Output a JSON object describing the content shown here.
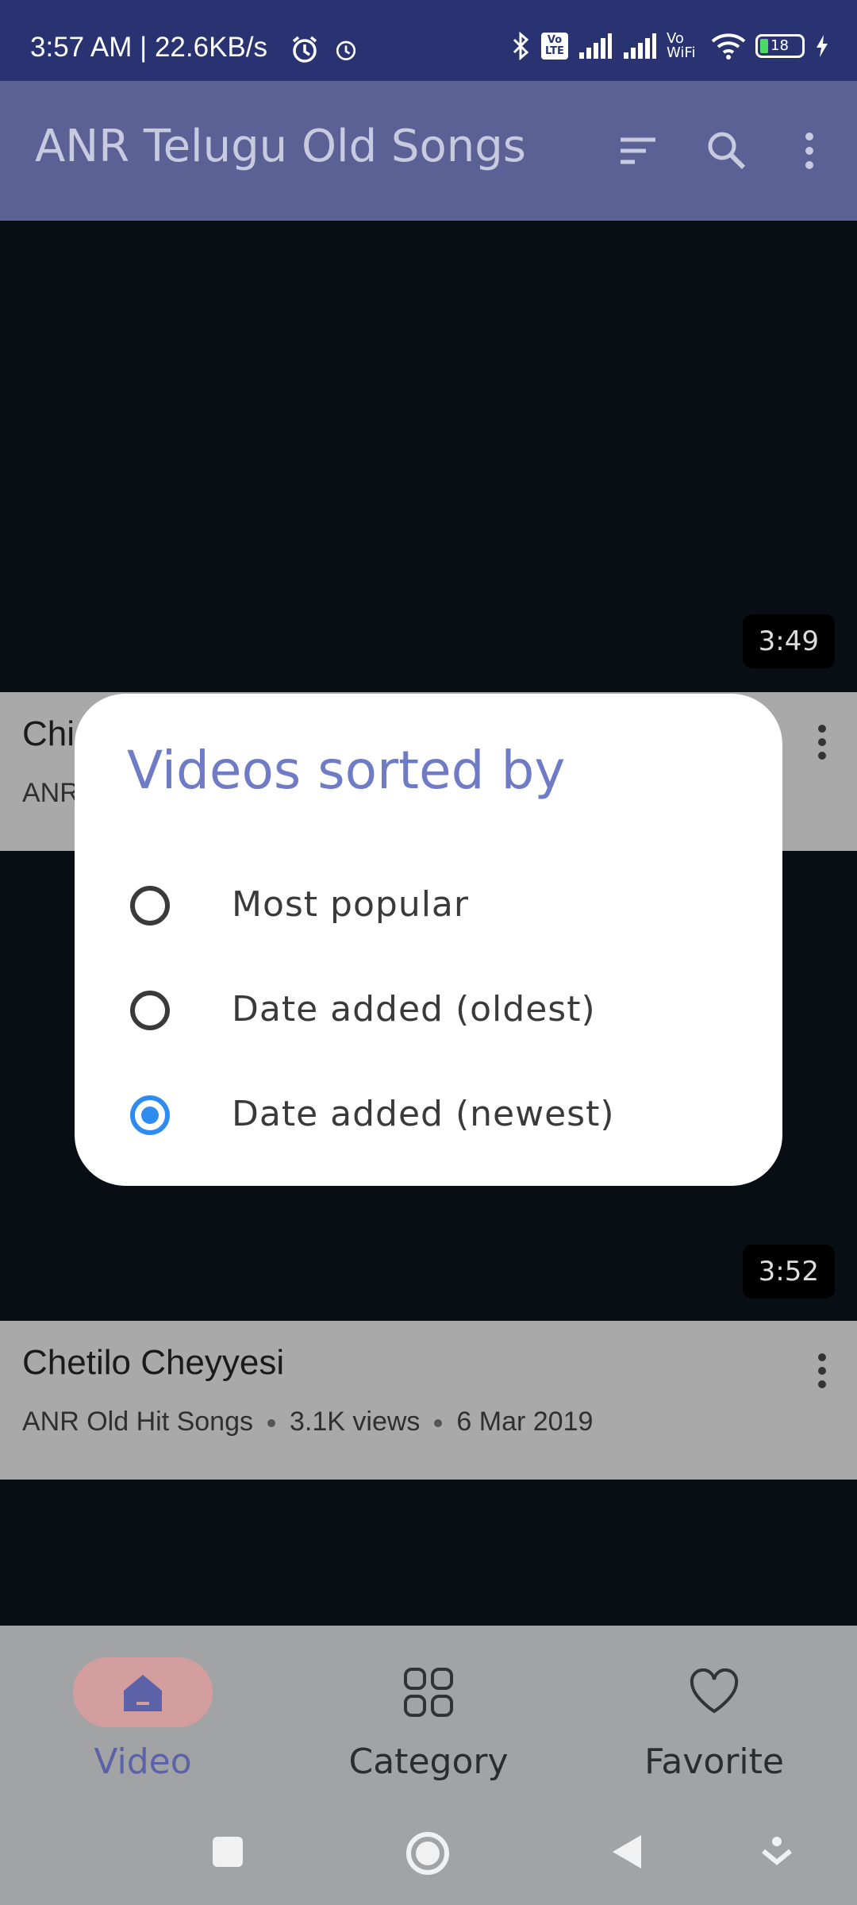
{
  "status_bar": {
    "time_speed": "3:57 AM | 22.6KB/s",
    "network": [
      "Vo LTE",
      "Vo WiFi"
    ],
    "battery": "18"
  },
  "app_bar": {
    "title": "ANR Telugu Old Songs",
    "actions": [
      "sort-icon",
      "search-icon",
      "more-vert-icon"
    ]
  },
  "videos": [
    {
      "duration": "3:49",
      "title": "Chi",
      "meta": "ANR"
    },
    {
      "duration": "3:52",
      "title": "Chetilo Cheyyesi",
      "channel": "ANR Old Hit Songs",
      "views": "3.1K views",
      "date": "6 Mar 2019"
    }
  ],
  "dialog": {
    "title": "Videos sorted by",
    "options": [
      {
        "label": "Most popular",
        "selected": false
      },
      {
        "label": "Date added (oldest)",
        "selected": false
      },
      {
        "label": "Date added (newest)",
        "selected": true
      }
    ]
  },
  "bottom_nav": {
    "items": [
      {
        "label": "Video",
        "icon": "home-icon",
        "active": true
      },
      {
        "label": "Category",
        "icon": "grid-icon",
        "active": false
      },
      {
        "label": "Favorite",
        "icon": "heart-icon",
        "active": false
      }
    ]
  },
  "colors": {
    "status_bar": "#293372",
    "app_bar": "#5b6195",
    "dialog_title": "#6f7bc4",
    "radio_selected": "#2e8cf0",
    "active_nav_pill": "#d49e9e"
  }
}
